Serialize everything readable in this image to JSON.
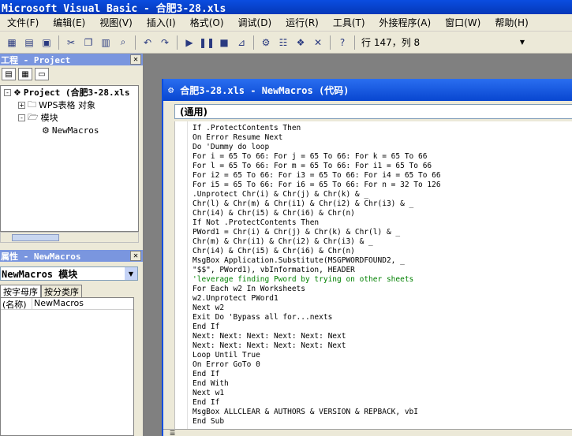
{
  "window": {
    "title": "Microsoft Visual Basic - 合肥3-28.xls"
  },
  "menu": [
    "文件(F)",
    "编辑(E)",
    "视图(V)",
    "插入(I)",
    "格式(O)",
    "调试(D)",
    "运行(R)",
    "工具(T)",
    "外接程序(A)",
    "窗口(W)",
    "帮助(H)"
  ],
  "toolbar": {
    "cursor_position": "行 147，列 8",
    "icons": [
      "view-excel-icon",
      "insert-module-icon",
      "save-icon",
      "cut-icon",
      "copy-icon",
      "paste-icon",
      "find-icon",
      "undo-icon",
      "redo-icon",
      "run-icon",
      "pause-icon",
      "stop-icon",
      "design-mode-icon",
      "project-explorer-icon",
      "properties-icon",
      "object-browser-icon",
      "toolbox-icon",
      "help-icon"
    ]
  },
  "project_pane": {
    "title": "工程 - Project",
    "tree": [
      {
        "label": "Project (合肥3-28.xls",
        "level": 0,
        "expander": "-"
      },
      {
        "label": "WPS表格 对象",
        "level": 1,
        "expander": "+"
      },
      {
        "label": "模块",
        "level": 1,
        "expander": "-"
      },
      {
        "label": "NewMacros",
        "level": 2,
        "expander": ""
      }
    ]
  },
  "properties_pane": {
    "title": "属性 - NewMacros",
    "selected_object": "NewMacros 模块",
    "tabs": [
      "按字母序",
      "按分类序"
    ],
    "rows": [
      {
        "key": "(名称)",
        "value": "NewMacros"
      }
    ]
  },
  "code_window": {
    "title": "合肥3-28.xls - NewMacros (代码)",
    "object_combo": "(通用)",
    "lines": [
      {
        "text": "If .ProtectContents Then",
        "comment": false
      },
      {
        "text": "On Error Resume Next",
        "comment": false
      },
      {
        "text": "Do 'Dummy do loop",
        "comment": false
      },
      {
        "text": "For i = 65 To 66: For j = 65 To 66: For k = 65 To 66",
        "comment": false
      },
      {
        "text": "For l = 65 To 66: For m = 65 To 66: For i1 = 65 To 66",
        "comment": false
      },
      {
        "text": "For i2 = 65 To 66: For i3 = 65 To 66: For i4 = 65 To 66",
        "comment": false
      },
      {
        "text": "For i5 = 65 To 66: For i6 = 65 To 66: For n = 32 To 126",
        "comment": false
      },
      {
        "text": ".Unprotect Chr(i) & Chr(j) & Chr(k) & _",
        "comment": false
      },
      {
        "text": "Chr(l) & Chr(m) & Chr(i1) & Chr(i2) & Chr(i3) & _",
        "comment": false
      },
      {
        "text": "Chr(i4) & Chr(i5) & Chr(i6) & Chr(n)",
        "comment": false
      },
      {
        "text": "If Not .ProtectContents Then",
        "comment": false
      },
      {
        "text": "PWord1 = Chr(i) & Chr(j) & Chr(k) & Chr(l) & _",
        "comment": false
      },
      {
        "text": "Chr(m) & Chr(i1) & Chr(i2) & Chr(i3) & _",
        "comment": false
      },
      {
        "text": "Chr(i4) & Chr(i5) & Chr(i6) & Chr(n)",
        "comment": false
      },
      {
        "text": "MsgBox Application.Substitute(MSGPWORDFOUND2, _",
        "comment": false
      },
      {
        "text": "\"$$\", PWord1), vbInformation, HEADER",
        "comment": false
      },
      {
        "text": "'leverage finding Pword by trying on other sheets",
        "comment": true
      },
      {
        "text": "For Each w2 In Worksheets",
        "comment": false
      },
      {
        "text": "w2.Unprotect PWord1",
        "comment": false
      },
      {
        "text": "Next w2",
        "comment": false
      },
      {
        "text": "Exit Do 'Bypass all for...nexts",
        "comment": false
      },
      {
        "text": "End If",
        "comment": false
      },
      {
        "text": "Next: Next: Next: Next: Next: Next",
        "comment": false
      },
      {
        "text": "Next: Next: Next: Next: Next: Next",
        "comment": false
      },
      {
        "text": "Loop Until True",
        "comment": false
      },
      {
        "text": "On Error GoTo 0",
        "comment": false
      },
      {
        "text": "End If",
        "comment": false
      },
      {
        "text": "End With",
        "comment": false
      },
      {
        "text": "Next w1",
        "comment": false
      },
      {
        "text": "End If",
        "comment": false
      },
      {
        "text": "MsgBox ALLCLEAR & AUTHORS & VERSION & REPBACK, vbI",
        "comment": false
      },
      {
        "text": "End Sub",
        "comment": false
      }
    ]
  }
}
